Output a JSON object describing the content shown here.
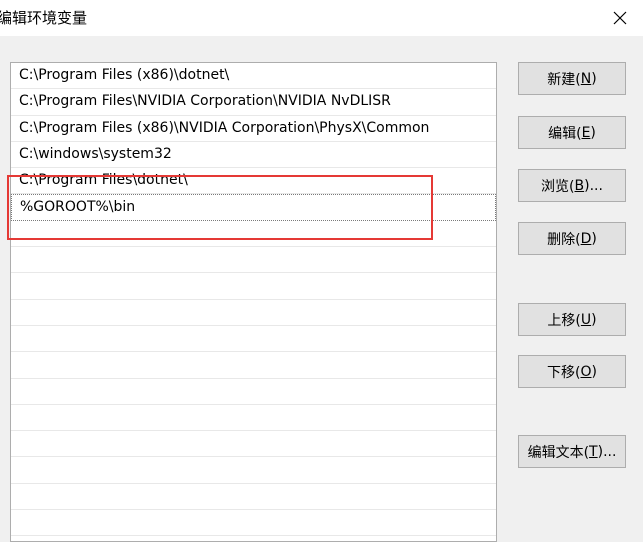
{
  "window": {
    "title": "编辑环境变量"
  },
  "list": {
    "items": [
      "C:\\Program Files (x86)\\dotnet\\",
      "C:\\Program Files\\NVIDIA Corporation\\NVIDIA NvDLISR",
      "C:\\Program Files (x86)\\NVIDIA Corporation\\PhysX\\Common",
      "C:\\windows\\system32",
      "C:\\Program Files\\dotnet\\",
      "%GOROOT%\\bin"
    ],
    "editing_index": 5
  },
  "buttons": {
    "new": {
      "pre": "新建(",
      "acc": "N",
      "post": ")"
    },
    "edit": {
      "pre": "编辑(",
      "acc": "E",
      "post": ")"
    },
    "browse": {
      "pre": "浏览(",
      "acc": "B",
      "post": ")..."
    },
    "delete": {
      "pre": "删除(",
      "acc": "D",
      "post": ")"
    },
    "move_up": {
      "pre": "上移(",
      "acc": "U",
      "post": ")"
    },
    "move_down": {
      "pre": "下移(",
      "acc": "O",
      "post": ")"
    },
    "edit_text": {
      "pre": "编辑文本(",
      "acc": "T",
      "post": ")..."
    }
  },
  "colors": {
    "highlight": "#e53935",
    "button_bg": "#e1e1e1",
    "dialog_bg": "#f0f0f0"
  },
  "icons": {
    "close": "close-icon"
  }
}
